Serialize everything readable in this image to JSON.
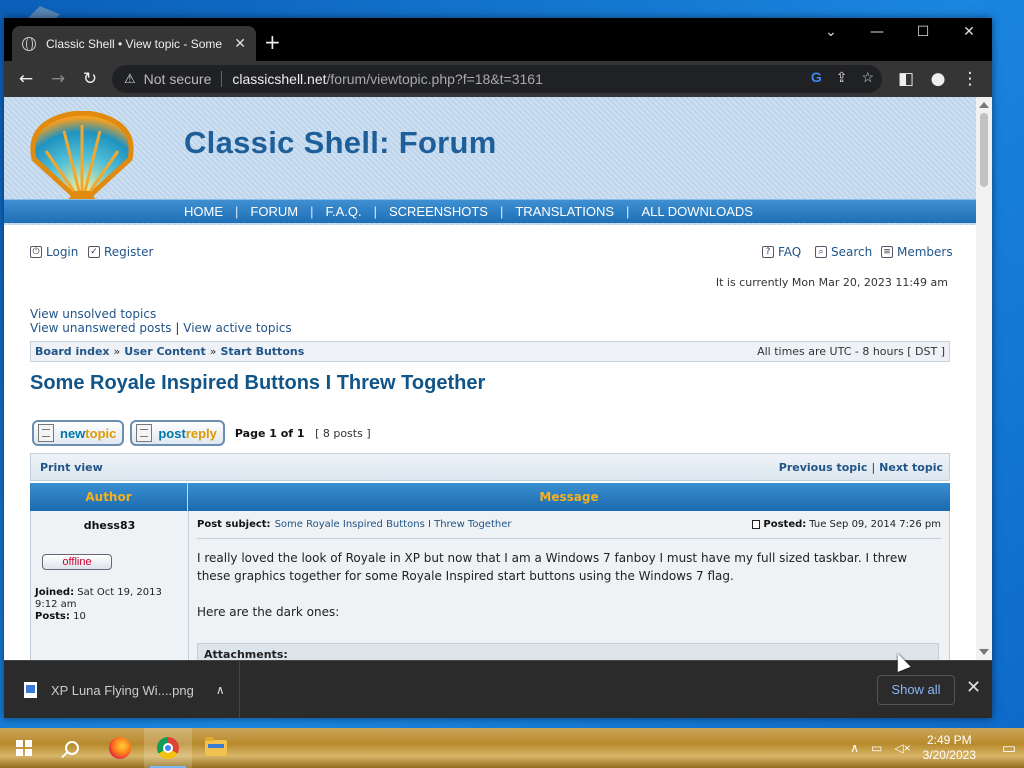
{
  "browser": {
    "tab_title": "Classic Shell • View topic - Some",
    "not_secure": "Not secure",
    "url_host": "classicshell.net",
    "url_path": "/forum/viewtopic.php?f=18&t=3161"
  },
  "forum": {
    "title": "Classic Shell: Forum",
    "nav": [
      "HOME",
      "FORUM",
      "F.A.Q.",
      "SCREENSHOTS",
      "TRANSLATIONS",
      "ALL DOWNLOADS"
    ],
    "login": "Login",
    "register": "Register",
    "faq": "FAQ",
    "search": "Search",
    "members": "Members",
    "current_time": "It is currently Mon Mar 20, 2023 11:49 am",
    "view_unsolved": "View unsolved topics",
    "view_unanswered": "View unanswered posts",
    "view_active": "View active topics",
    "breadcrumb": [
      "Board index",
      "User Content",
      "Start Buttons"
    ],
    "timezone": "All times are UTC - 8 hours [ DST ]",
    "topic_title": "Some Royale Inspired Buttons I Threw Together",
    "new_topic_a": "new",
    "new_topic_b": "topic",
    "post_reply_a": "post",
    "post_reply_b": "reply",
    "page_info": "Page 1 of 1",
    "posts_count": "[ 8 posts ]",
    "print_view": "Print view",
    "prev_topic": "Previous topic",
    "next_topic": "Next topic",
    "col_author": "Author",
    "col_message": "Message"
  },
  "post": {
    "author": "dhess83",
    "status": "offline",
    "joined_label": "Joined:",
    "joined": "Sat Oct 19, 2013 9:12 am",
    "posts_label": "Posts:",
    "posts": "10",
    "subject_label": "Post subject:",
    "subject": "Some Royale Inspired Buttons I Threw Together",
    "posted_label": "Posted:",
    "posted": "Tue Sep 09, 2014 7:26 pm",
    "body_1": "I really loved the look of Royale in XP but now that I am a Windows 7 fanboy I must have my full sized taskbar. I threw these graphics together for some Royale Inspired start buttons using the Windows 7 flag.",
    "body_2": "Here are the dark ones:",
    "attachments": "Attachments:"
  },
  "downloads": {
    "file": "XP Luna Flying Wi....png",
    "show_all": "Show all"
  },
  "taskbar": {
    "time": "2:49 PM",
    "date": "3/20/2023"
  }
}
